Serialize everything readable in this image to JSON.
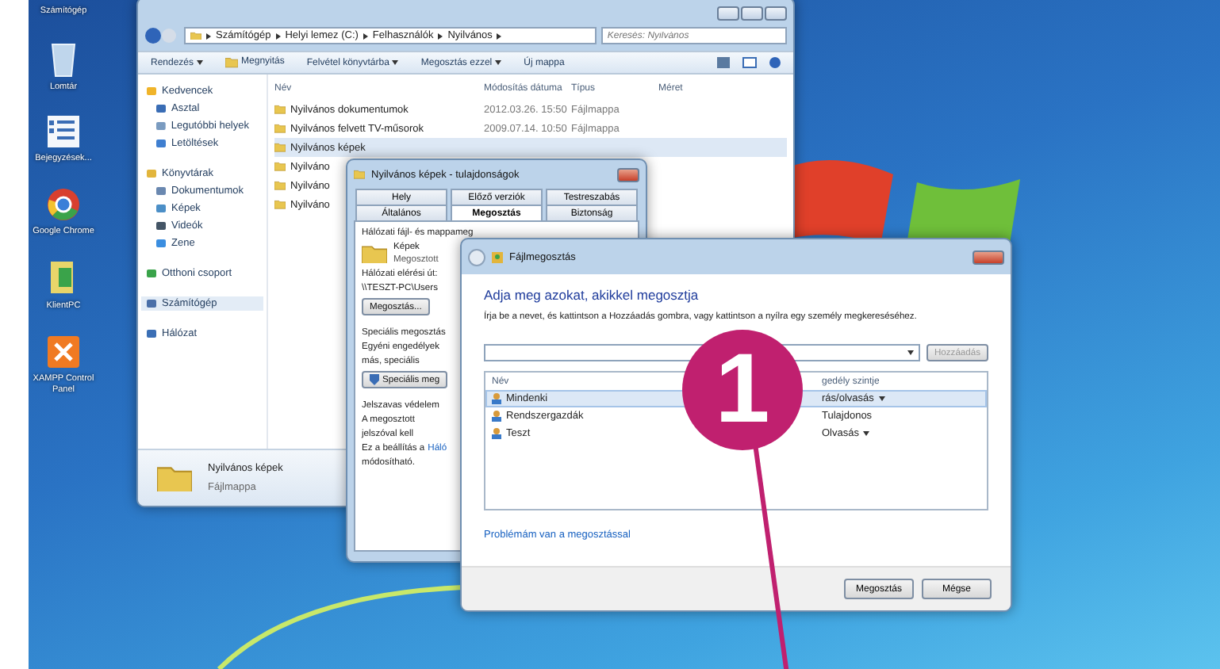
{
  "desktop_icons": [
    {
      "label": "Számítógép"
    },
    {
      "label": "Lomtár"
    },
    {
      "label": "Bejegyzések..."
    },
    {
      "label": "Google Chrome"
    },
    {
      "label": "KlientPC"
    },
    {
      "label": "XAMPP Control Panel"
    }
  ],
  "explorer": {
    "breadcrumbs": [
      "Számítógép",
      "Helyi lemez (C:)",
      "Felhasználók",
      "Nyilvános"
    ],
    "search": {
      "placeholder": "Keresés: Nyilvános"
    },
    "toolbar": [
      {
        "label": "Rendezés",
        "menu": true
      },
      {
        "label": "Megnyitás",
        "menu": false
      },
      {
        "label": "Felvétel könyvtárba",
        "menu": true
      },
      {
        "label": "Megosztás ezzel",
        "menu": true
      },
      {
        "label": "Új mappa",
        "menu": false
      }
    ],
    "sidebar": [
      {
        "label": "Kedvencek",
        "selected": false,
        "children": [
          {
            "label": "Asztal",
            "selected": false
          },
          {
            "label": "Legutóbbi helyek",
            "selected": false
          },
          {
            "label": "Letöltések",
            "selected": false
          }
        ]
      },
      {
        "label": "Könyvtárak",
        "selected": false,
        "children": [
          {
            "label": "Dokumentumok",
            "selected": false
          },
          {
            "label": "Képek",
            "selected": false
          },
          {
            "label": "Videók",
            "selected": false
          },
          {
            "label": "Zene",
            "selected": false
          }
        ]
      },
      {
        "label": "Otthoni csoport",
        "selected": false
      },
      {
        "label": "Számítógép",
        "selected": true
      },
      {
        "label": "Hálózat",
        "selected": false
      }
    ],
    "columns": [
      "Név",
      "Módosítás dátuma",
      "Típus",
      "Méret"
    ],
    "rows": [
      {
        "name": "Nyilvános dokumentumok",
        "date": "2012.03.26. 15:50",
        "type": "Fájlmappa",
        "selected": false
      },
      {
        "name": "Nyilvános felvett TV-műsorok",
        "date": "2009.07.14. 10:50",
        "type": "Fájlmappa",
        "selected": false
      },
      {
        "name": "Nyilvános képek",
        "selected": true
      },
      {
        "name": "Nyilváno",
        "selected": false
      },
      {
        "name": "Nyilváno",
        "selected": false
      },
      {
        "name": "Nyilváno",
        "selected": false
      }
    ],
    "status": {
      "name": "Nyilvános képek",
      "type": "Fájlmappa"
    }
  },
  "properties": {
    "title": "Nyilvános képek - tulajdonságok",
    "tabs": [
      [
        {
          "label": "Hely",
          "selected": false
        },
        {
          "label": "Előző verziók",
          "selected": false
        },
        {
          "label": "Testreszabás",
          "selected": false
        }
      ],
      [
        {
          "label": "Általános",
          "selected": false
        },
        {
          "label": "Megosztás",
          "selected": true
        },
        {
          "label": "Biztonság",
          "selected": false
        }
      ]
    ],
    "network_heading": "Hálózati fájl- és mappameg",
    "folder_name": "Képek",
    "folder_state": "Megosztott",
    "path_label": "Hálózati elérési út:",
    "path": "\\\\TESZT-PC\\Users",
    "share_button": "Megosztás...",
    "advanced_heading": "Speciális megosztás",
    "advanced_text": [
      "Egyéni engedélyek",
      "más, speciális"
    ],
    "advanced_button": "Speciális meg",
    "password_heading": "Jelszavas védelem",
    "password_text": [
      "A megosztott",
      "jelszóval kell"
    ],
    "setting_text": "Ez a beállítás a",
    "setting_link": "Háló",
    "setting_end": "módosítható."
  },
  "sharing": {
    "title": "Fájlmegosztás",
    "heading": "Adja meg azokat, akikkel megosztja",
    "instruction": "Írja be a nevet, és kattintson a Hozzáadás gombra, vagy kattintson a nyílra egy személy megkereséséhez.",
    "add_button": {
      "label": "Hozzáadás",
      "disabled": true
    },
    "columns": [
      "Név",
      "gedély szintje"
    ],
    "rows": [
      {
        "name": "Mindenki",
        "permission": "rás/olvasás",
        "menu": true,
        "selected": true
      },
      {
        "name": "Rendszergazdák",
        "permission": "Tulajdonos",
        "menu": false,
        "selected": false
      },
      {
        "name": "Teszt",
        "permission": "Olvasás",
        "menu": true,
        "selected": false
      }
    ],
    "help_link": "Problémám van a megosztással",
    "buttons": [
      "Megosztás",
      "Mégse"
    ]
  },
  "callout": {
    "label": "1"
  }
}
